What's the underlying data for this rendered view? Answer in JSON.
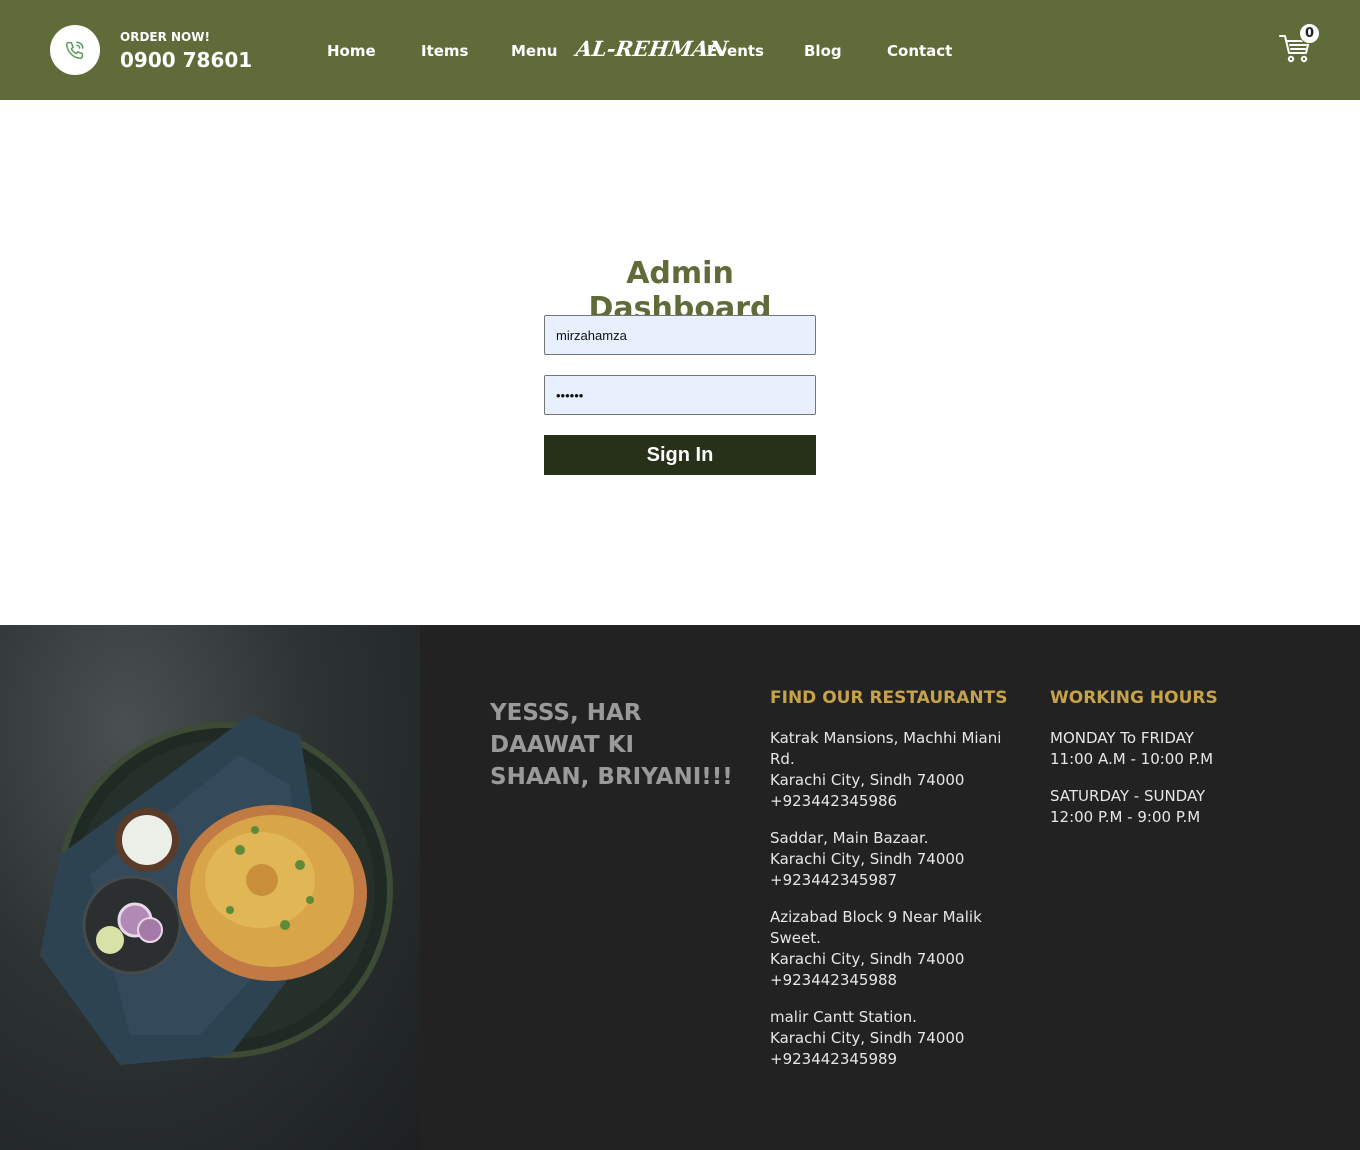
{
  "header": {
    "order_label": "ORDER NOW!",
    "order_phone": "0900 78601",
    "nav": [
      "Home",
      "Items",
      "Menu",
      "Events",
      "Blog",
      "Contact"
    ],
    "logo": "AL-REHMAN",
    "cart_count": "0",
    "icons": {
      "phone": "phone-icon",
      "cart": "cart-icon"
    },
    "colors": {
      "bar": "#5f6b38"
    }
  },
  "login": {
    "title": "Admin Dashboard",
    "username_value": "mirzahamza",
    "password_value": "••••••",
    "sign_in_label": "Sign In",
    "colors": {
      "title": "#5f6b38",
      "button": "#27311a",
      "field_bg": "#e8f0fe"
    }
  },
  "footer": {
    "tagline": "YESSS, HAR DAAWAT KI SHAAN, BRIYANI!!!",
    "restaurants_heading": "FIND OUR RESTAURANTS",
    "restaurants": [
      {
        "street": "Katrak Mansions, Machhi Miani Rd.",
        "city": "Karachi City, Sindh 74000",
        "phone": "+923442345986"
      },
      {
        "street": "Saddar, Main Bazaar.",
        "city": "Karachi City, Sindh 74000",
        "phone": "+923442345987"
      },
      {
        "street": "Azizabad Block 9 Near Malik Sweet.",
        "city": "Karachi City, Sindh 74000",
        "phone": "+923442345988"
      },
      {
        "street": "malir Cantt Station.",
        "city": "Karachi City, Sindh 74000",
        "phone": "+923442345989"
      }
    ],
    "hours_heading": "WORKING HOURS",
    "hours": [
      {
        "days": "MONDAY To FRIDAY",
        "time": "11:00 A.M - 10:00 P.M"
      },
      {
        "days": "SATURDAY - SUNDAY",
        "time": "12:00 P.M - 9:00 P.M"
      }
    ],
    "colors": {
      "background": "#222222",
      "heading": "#c6a24a",
      "tagline": "#9a9a9a"
    }
  }
}
